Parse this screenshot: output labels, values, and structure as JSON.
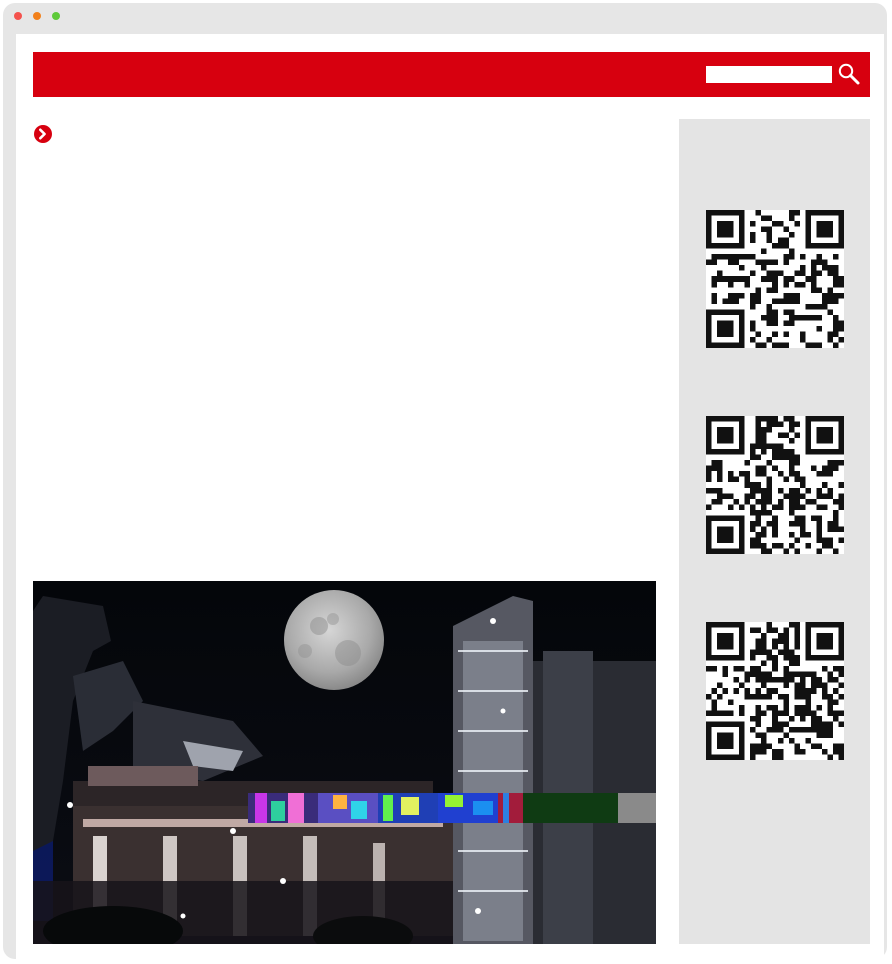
{
  "window": {
    "controls": [
      "close",
      "minimize",
      "maximize"
    ]
  },
  "header": {
    "brand_color": "#d7000f",
    "search": {
      "value": "",
      "placeholder": ""
    },
    "search_button_icon": "search-icon"
  },
  "content": {
    "bullet_icon": "chevron-right-circle-icon",
    "photo_description_icon": "night-factory-full-moon-photo"
  },
  "sidebar": {
    "qr_codes": [
      "qr-code-1",
      "qr-code-2",
      "qr-code-3"
    ]
  }
}
